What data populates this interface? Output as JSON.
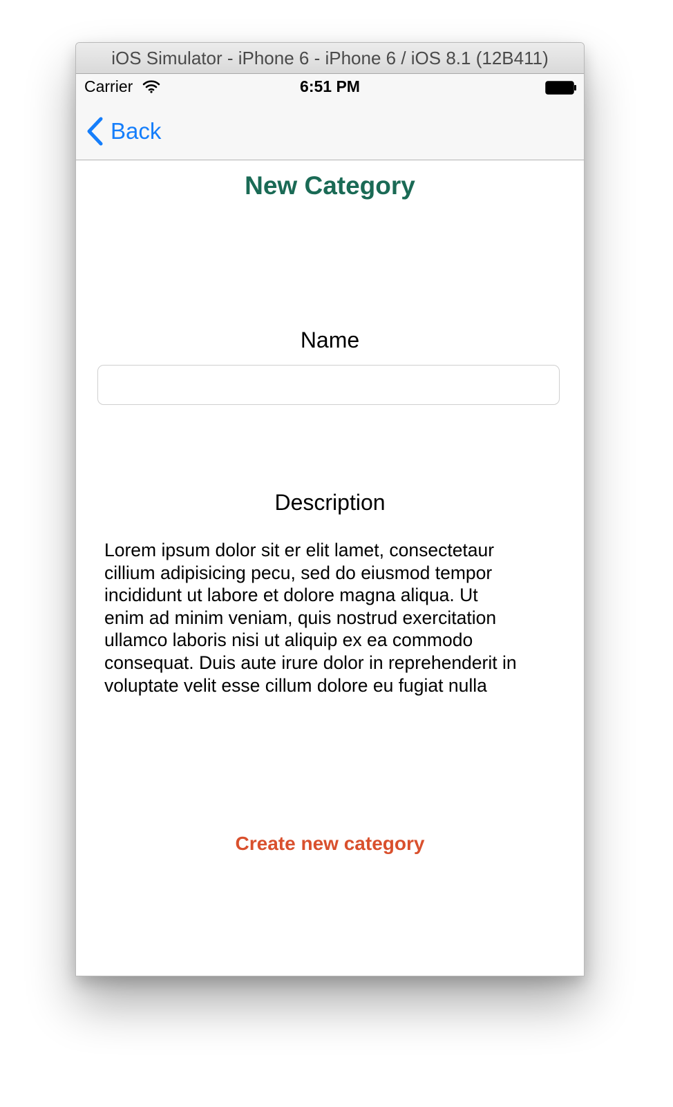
{
  "window": {
    "title": "iOS Simulator - iPhone 6 - iPhone 6 / iOS 8.1 (12B411)"
  },
  "status_bar": {
    "carrier": "Carrier",
    "wifi_icon": "wifi-icon",
    "time": "6:51 PM",
    "battery_icon": "battery-icon"
  },
  "nav_bar": {
    "back_icon": "chevron-left-icon",
    "back_label": "Back"
  },
  "form": {
    "title": "New Category",
    "name_label": "Name",
    "name_value": "",
    "description_label": "Description",
    "description_text": "Lorem ipsum dolor sit er elit lamet, consectetaur\ncillium adipisicing pecu, sed do eiusmod tempor\nincididunt ut labore et dolore magna aliqua. Ut\nenim ad minim veniam, quis nostrud exercitation\nullamco laboris nisi ut aliquip ex ea commodo\nconsequat. Duis aute irure dolor in reprehenderit in\nvoluptate velit esse cillum dolore eu fugiat nulla",
    "create_button_label": "Create new category"
  },
  "colors": {
    "title_green": "#1a6a55",
    "ios_blue": "#157efb",
    "action_orange": "#d9502d"
  }
}
